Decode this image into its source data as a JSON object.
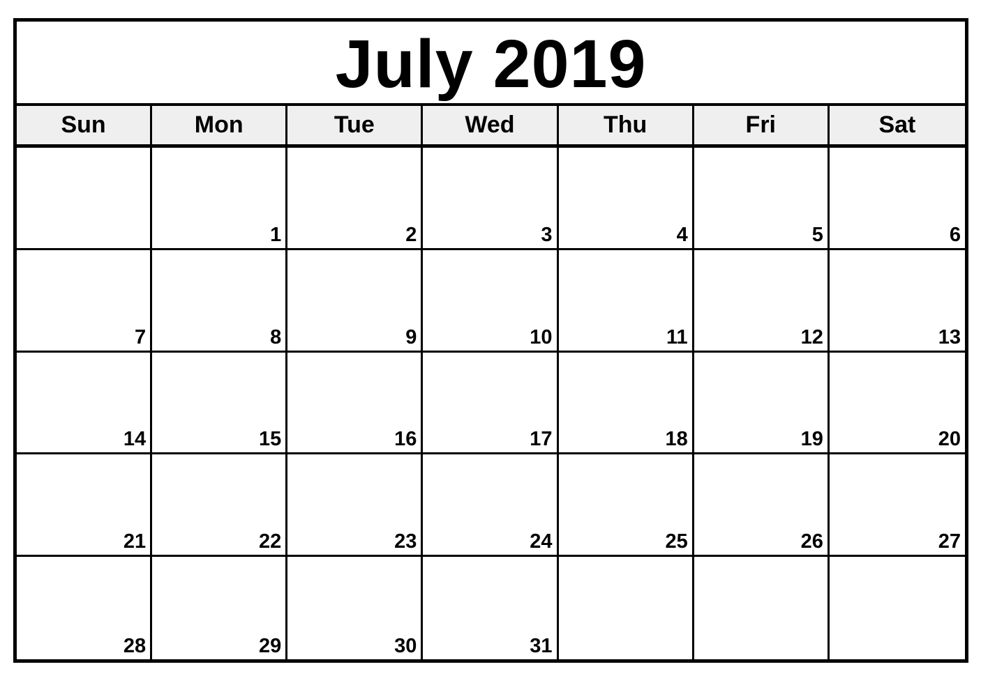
{
  "calendar": {
    "title": "July 2019",
    "month": "July",
    "year": "2019",
    "weekdays": [
      "Sun",
      "Mon",
      "Tue",
      "Wed",
      "Thu",
      "Fri",
      "Sat"
    ],
    "weeks": [
      [
        "",
        "1",
        "2",
        "3",
        "4",
        "5",
        "6"
      ],
      [
        "7",
        "8",
        "9",
        "10",
        "11",
        "12",
        "13"
      ],
      [
        "14",
        "15",
        "16",
        "17",
        "18",
        "19",
        "20"
      ],
      [
        "21",
        "22",
        "23",
        "24",
        "25",
        "26",
        "27"
      ],
      [
        "28",
        "29",
        "30",
        "31",
        "",
        "",
        ""
      ]
    ]
  },
  "colors": {
    "border": "#000000",
    "header_background": "#efefef",
    "background": "#ffffff",
    "text": "#000000"
  }
}
